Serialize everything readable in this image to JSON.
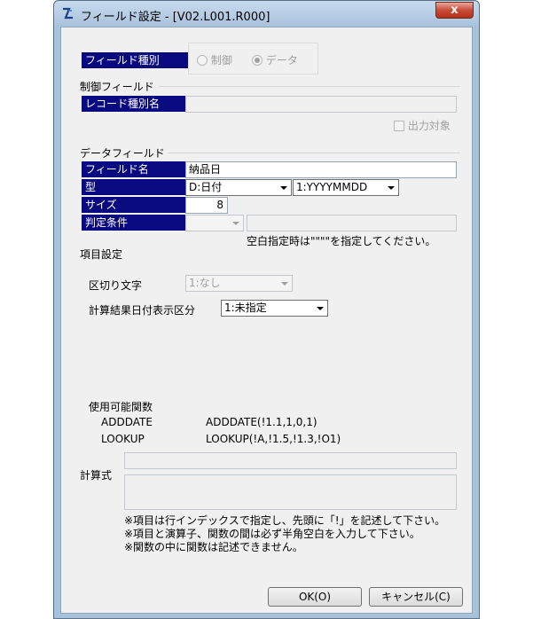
{
  "window": {
    "title": "フィールド設定 - [V02.L001.R000]",
    "close_glyph": "x"
  },
  "field_type": {
    "label": "フィールド種別",
    "options": [
      "制御",
      "データ"
    ],
    "selected": "データ"
  },
  "control_field": {
    "section_title": "制御フィールド",
    "record_type_label": "レコード種別名",
    "record_type_value": "",
    "output_target_label": "出力対象"
  },
  "data_field": {
    "section_title": "データフィールド",
    "name_label": "フィールド名",
    "name_value": "納品日",
    "type_label": "型",
    "type_value": "D:日付",
    "format_value": "1:YYYYMMDD",
    "size_label": "サイズ",
    "size_value": "8",
    "condition_label": "判定条件",
    "condition_value": "",
    "condition_text": "",
    "blank_note": "空白指定時は\"\"\"\"を指定してください。"
  },
  "item_settings": {
    "title": "項目設定",
    "delimiter_label": "区切り文字",
    "delimiter_value": "1:なし",
    "date_display_label": "計算結果日付表示区分",
    "date_display_value": "1:未指定"
  },
  "functions": {
    "title": "使用可能関数",
    "items": [
      {
        "name": "ADDDATE",
        "syntax": "ADDDATE(!1.1,1,0,1)"
      },
      {
        "name": "LOOKUP",
        "syntax": "LOOKUP(!A,!1.5,!1.3,!O1)"
      }
    ]
  },
  "formula": {
    "label": "計算式",
    "line1": "",
    "body": ""
  },
  "notes": [
    "※項目は行インデックスで指定し、先頭に「!」を記述して下さい。",
    "※項目と演算子、関数の間は必ず半角空白を入力して下さい。",
    "※関数の中に関数は記述できません。"
  ],
  "buttons": {
    "ok": "OK(O)",
    "cancel": "キャンセル(C)"
  }
}
